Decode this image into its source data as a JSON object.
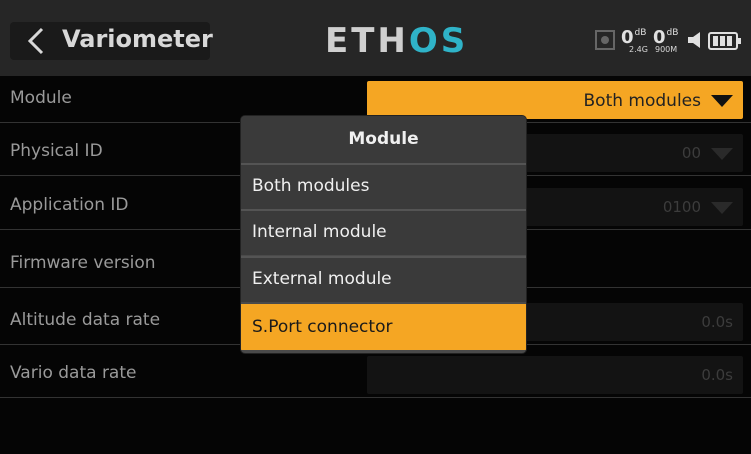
{
  "header": {
    "title": "Variometer",
    "logo_part1": "ETH",
    "logo_part2": "OS",
    "rssi1_value": "0",
    "rssi1_unit": "dB",
    "rssi2_value": "0",
    "rssi2_unit": "dB",
    "band1": "2.4G",
    "band2": "900M"
  },
  "rows": [
    {
      "label": "Module",
      "value": "Both modules"
    },
    {
      "label": "Physical ID",
      "value": "00"
    },
    {
      "label": "Application ID",
      "value": "0100"
    },
    {
      "label": "Firmware version",
      "value": ""
    },
    {
      "label": "Altitude data rate",
      "value": "0.0s"
    },
    {
      "label": "Vario data rate",
      "value": "0.0s"
    }
  ],
  "modal": {
    "title": "Module",
    "options": [
      "Both modules",
      "Internal module",
      "External module",
      "S.Port connector"
    ],
    "selected": "S.Port connector"
  },
  "colors": {
    "accent": "#f5a623",
    "logo_accent": "#2fb3c8"
  }
}
